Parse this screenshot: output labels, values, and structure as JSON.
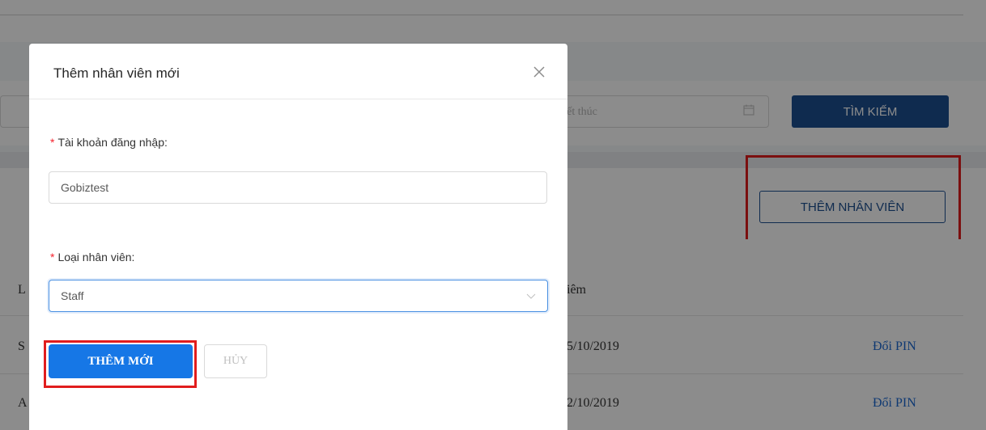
{
  "background": {
    "date_placeholder": "Kết thúc",
    "search_label": "TÌM KIẾM",
    "add_employee_label": "THÊM NHÂN VIÊN",
    "table": {
      "header_partial_left": "L",
      "header_partial_right": "iêm",
      "rows": [
        {
          "partial_left": "S",
          "date_partial": "5/10/2019",
          "action": "Đổi PIN"
        },
        {
          "partial_left": "A",
          "date_partial": "2/10/2019",
          "action": "Đổi PIN"
        }
      ]
    }
  },
  "modal": {
    "title": "Thêm nhân viên mới",
    "close_symbol": "×",
    "fields": {
      "account": {
        "required_mark": "*",
        "label": "Tài khoản đăng nhập:",
        "value": "Gobiztest"
      },
      "type": {
        "required_mark": "*",
        "label": "Loại nhân viên:",
        "value": "Staff"
      }
    },
    "submit_label": "THÊM MỚI",
    "cancel_label": "HỦY"
  },
  "colors": {
    "primary": "#1d4f91",
    "submit": "#1677e6",
    "highlight": "#e11d1d",
    "link": "#1d69d1"
  }
}
